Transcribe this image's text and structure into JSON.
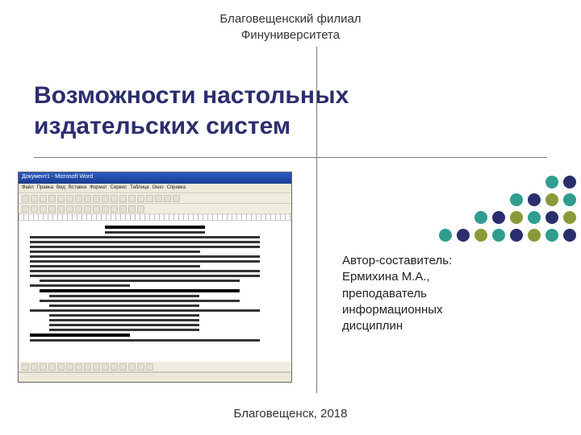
{
  "header": {
    "line1": "Благовещенский филиал",
    "line2": "Финуниверситета"
  },
  "title": {
    "line1": "Возможности настольных",
    "line2": "издательских систем"
  },
  "screenshot": {
    "titlebar": "Документ1 - Microsoft Word",
    "menu": [
      "Файл",
      "Правка",
      "Вид",
      "Вставка",
      "Формат",
      "Сервис",
      "Таблица",
      "Окно",
      "Справка"
    ]
  },
  "author": {
    "l1": "Автор-составитель:",
    "l2": "Ермихина М.А.,",
    "l3": "преподаватель",
    "l4": "информационных",
    "l5": "дисциплин"
  },
  "footer": "Благовещенск, 2018",
  "dot_colors": {
    "teal": "#2f9d8f",
    "navy": "#2b2e6d",
    "olive": "#8a9a3a"
  },
  "dots_layout": [
    [
      null,
      null,
      null,
      null,
      null,
      null,
      null,
      null,
      "teal",
      "navy"
    ],
    [
      null,
      null,
      null,
      null,
      null,
      null,
      "teal",
      "navy",
      "olive",
      "teal"
    ],
    [
      null,
      null,
      null,
      null,
      "teal",
      "navy",
      "olive",
      "teal",
      "navy",
      "olive"
    ],
    [
      null,
      null,
      "teal",
      "navy",
      "olive",
      "teal",
      "navy",
      "olive",
      "teal",
      "navy"
    ]
  ]
}
